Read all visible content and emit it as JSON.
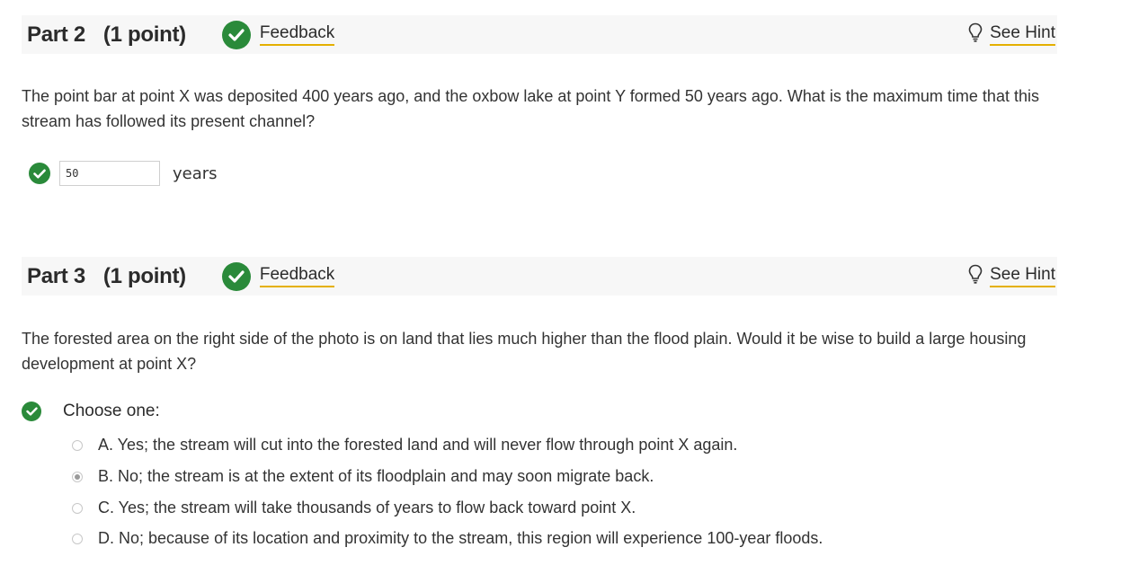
{
  "parts": [
    {
      "title": "Part 2",
      "points": "(1 point)",
      "feedback_label": "Feedback",
      "hint_label": "See Hint",
      "question": "The point bar at point X was deposited 400 years ago, and the oxbow lake at point Y formed 50 years ago. What is the maximum time that this stream has followed its present channel?",
      "answer_value": "50",
      "answer_units": "years"
    },
    {
      "title": "Part 3",
      "points": "(1 point)",
      "feedback_label": "Feedback",
      "hint_label": "See Hint",
      "question": "The forested area on the right side of the photo is on land that lies much higher than the flood plain. Would it be wise to build a large housing development at point X?",
      "choose_label": "Choose one:",
      "options": [
        {
          "text": "A. Yes; the stream will cut into the forested land and will never flow through point X again.",
          "selected": false
        },
        {
          "text": "B. No; the stream is at the extent of its floodplain and may soon migrate back.",
          "selected": true
        },
        {
          "text": "C. Yes; the stream will take thousands of years to flow back toward point X.",
          "selected": false
        },
        {
          "text": "D. No; because of its location and proximity to the stream, this region will experience 100-year floods.",
          "selected": false
        }
      ]
    }
  ],
  "colors": {
    "correct": "#2a8a3a",
    "link_underline": "#e4b000",
    "header_bg": "#f7f7f7"
  },
  "icons": {
    "correct": "check-circle-icon",
    "hint": "lightbulb-icon"
  }
}
